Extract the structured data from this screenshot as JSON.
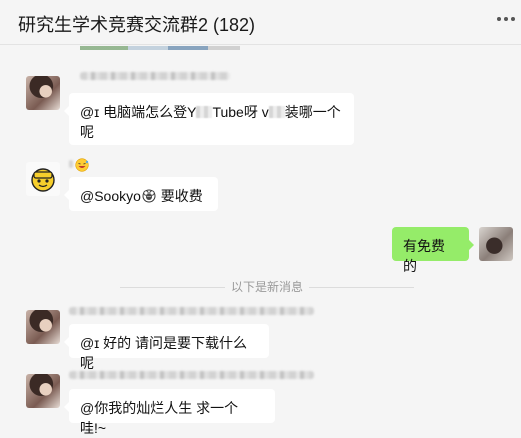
{
  "header": {
    "title": "研究生学术竞赛交流群2 (182)"
  },
  "messages": [
    {
      "sender": "other",
      "text_a": "@ɪ 电脑端怎么登Y",
      "text_b": "Tube呀 v",
      "text_c": "装哪一个",
      "text_d": "呢"
    },
    {
      "sender": "other",
      "text_a": "@Sookyo",
      "text_b": " 要收费"
    },
    {
      "sender": "me",
      "text": "有免费的"
    },
    {
      "sender": "other",
      "text": "@ɪ 好的 请问是要下载什么呢"
    },
    {
      "sender": "other",
      "text": "@你我的灿烂人生 求一个哇!~"
    }
  ],
  "new_messages_divider": "以下是新消息",
  "icons": {
    "more": "more-dots-icon",
    "laugh": "laugh-emoji-icon",
    "sheep": "sheep-emoji-icon",
    "emoji_avatar": "yellow-emoji-avatar-icon"
  },
  "colors": {
    "my_bubble": "#95ec69",
    "other_bubble": "#ffffff",
    "background": "#f5f5f5"
  }
}
